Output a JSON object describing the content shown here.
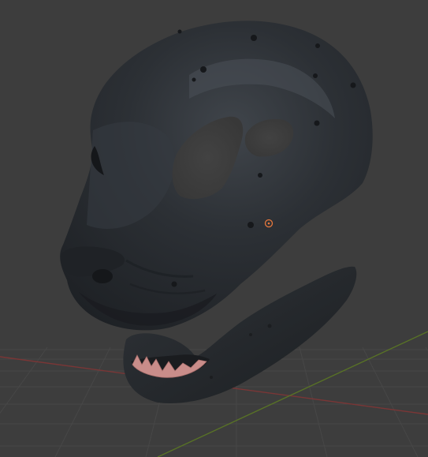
{
  "app": {
    "type": "3d-viewport",
    "view": "perspective"
  },
  "viewport": {
    "background_color": "#3d3d3d",
    "grid": {
      "visible": true,
      "line_color": "#474747",
      "x_axis_color": "#8a3a3a",
      "y_axis_color": "#5e7a2a"
    },
    "cursor_3d": {
      "visible": true,
      "color": "#e8783c"
    }
  },
  "scene": {
    "objects": [
      {
        "name": "mask-head",
        "material_color": "#2a2d31"
      },
      {
        "name": "mask-jaw",
        "material_color": "#2a2d31"
      },
      {
        "name": "teeth",
        "material_color": "#c98d8a"
      }
    ]
  }
}
